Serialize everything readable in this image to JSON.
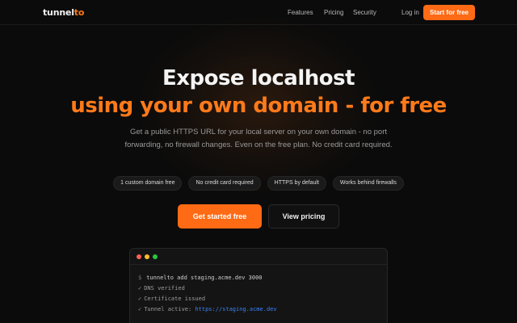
{
  "nav": {
    "logo_prefix": "tunnel",
    "logo_suffix": "to",
    "links": [
      "Features",
      "Pricing",
      "Security"
    ],
    "login": "Log in",
    "cta": "Start for free"
  },
  "hero": {
    "title_line1": "Expose localhost",
    "title_line2": "using your own domain - for free",
    "subtitle": "Get a public HTTPS URL for your local server on your own domain - no port forwarding, no firewall changes. Even on the free plan. No credit card required.",
    "badges": [
      "1 custom domain free",
      "No credit card required",
      "HTTPS by default",
      "Works behind firewalls"
    ],
    "primary_cta": "Get started free",
    "secondary_cta": "View pricing"
  },
  "terminal": {
    "prompt": "$",
    "command": "tunnelto add staging.acme.dev 3000",
    "check": "✓",
    "lines": [
      "DNS verified",
      "Certificate issued"
    ],
    "active_label": "Tunnel active:",
    "active_url": "https://staging.acme.dev"
  },
  "colors": {
    "accent": "#ff6a14",
    "background": "#0b0b0b",
    "dot_red": "#ff5f57",
    "dot_yellow": "#febc2e",
    "dot_green": "#28c840",
    "link": "#3b82f6"
  }
}
